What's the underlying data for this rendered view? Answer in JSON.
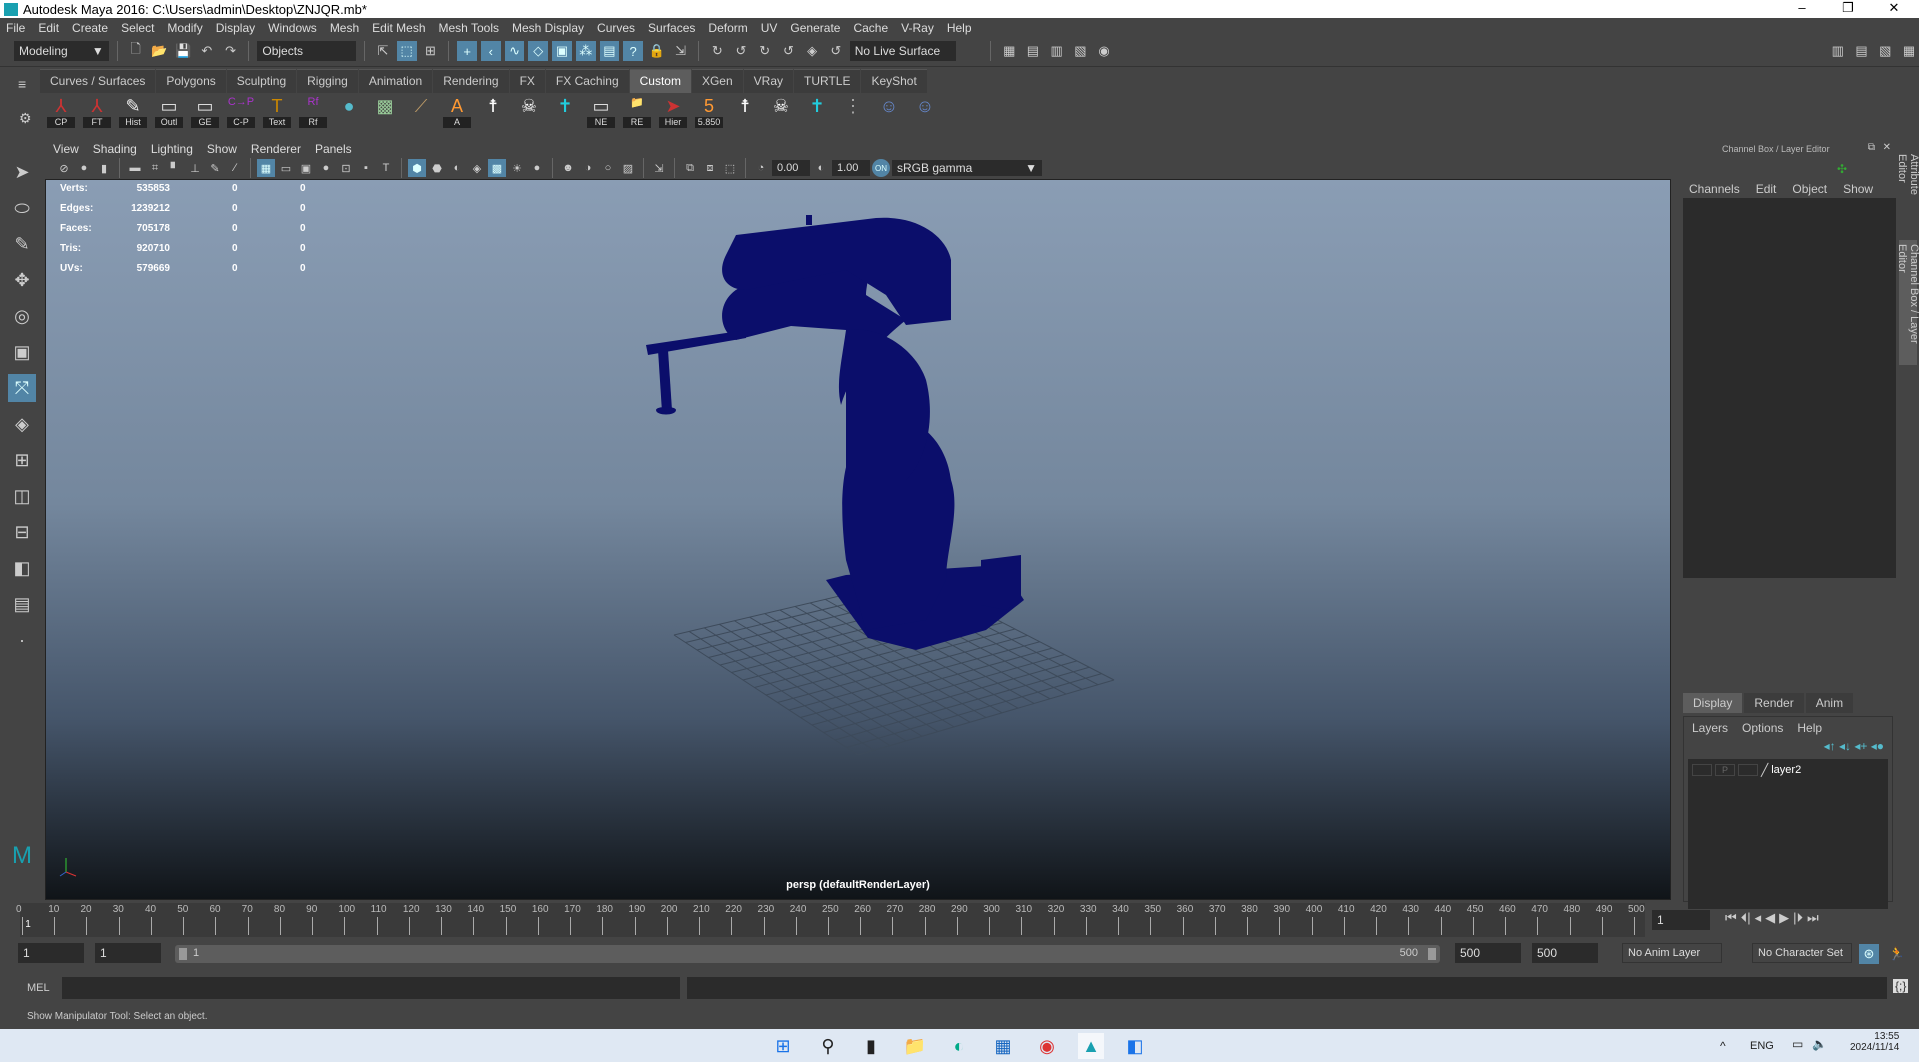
{
  "window": {
    "title": "Autodesk Maya 2016: C:\\Users\\admin\\Desktop\\ZNJQR.mb*",
    "minimize": "–",
    "restore": "❐",
    "close": "✕"
  },
  "menu": [
    "File",
    "Edit",
    "Create",
    "Select",
    "Modify",
    "Display",
    "Windows",
    "Mesh",
    "Edit Mesh",
    "Mesh Tools",
    "Mesh Display",
    "Curves",
    "Surfaces",
    "Deform",
    "UV",
    "Generate",
    "Cache",
    "V-Ray",
    "Help"
  ],
  "statusline": {
    "mode": "Modeling",
    "selection_mask": "Objects",
    "live_surface": "No Live Surface"
  },
  "shelf": {
    "tabs": [
      "Curves / Surfaces",
      "Polygons",
      "Sculpting",
      "Rigging",
      "Animation",
      "Rendering",
      "FX",
      "FX Caching",
      "Custom",
      "XGen",
      "VRay",
      "TURTLE",
      "KeyShot"
    ],
    "active_tab": "Custom",
    "buttons": [
      {
        "label": "CP",
        "icon": "axis-icon"
      },
      {
        "label": "FT",
        "icon": "axis-icon"
      },
      {
        "label": "Hist",
        "icon": "notepad-icon"
      },
      {
        "label": "Outl",
        "icon": "window-icon"
      },
      {
        "label": "GE",
        "icon": "window-icon"
      },
      {
        "label": "C-P",
        "icon": "c-p-icon"
      },
      {
        "label": "Text",
        "icon": "text-icon"
      },
      {
        "label": "Rf",
        "icon": "rf-icon"
      },
      {
        "label": "",
        "icon": "pin-icon"
      },
      {
        "label": "",
        "icon": "checker-icon"
      },
      {
        "label": "",
        "icon": "brush-icon"
      },
      {
        "label": "A",
        "icon": "a-circle-icon"
      },
      {
        "label": "",
        "icon": "skeleton-icon"
      },
      {
        "label": "",
        "icon": "skull-icon"
      },
      {
        "label": "",
        "icon": "cross-icon"
      },
      {
        "label": "NE",
        "icon": "window-icon"
      },
      {
        "label": "RE",
        "icon": "folder-icon"
      },
      {
        "label": "Hier",
        "icon": "cursor-icon"
      },
      {
        "label": "5.850",
        "icon": "five-circle-icon"
      },
      {
        "label": "",
        "icon": "skeleton-icon"
      },
      {
        "label": "",
        "icon": "skull-icon"
      },
      {
        "label": "",
        "icon": "cross-icon"
      },
      {
        "label": "",
        "icon": "graph-icon"
      },
      {
        "label": "",
        "icon": "head-icon"
      },
      {
        "label": "",
        "icon": "head-icon"
      }
    ]
  },
  "panel": {
    "menu": [
      "View",
      "Shading",
      "Lighting",
      "Show",
      "Renderer",
      "Panels"
    ],
    "exposure": "0.00",
    "gamma": "1.00",
    "color_space": "sRGB gamma",
    "camera_label": "persp (defaultRenderLayer)"
  },
  "hud": [
    {
      "label": "Verts:",
      "value": "535853",
      "a": "0",
      "b": "0"
    },
    {
      "label": "Edges:",
      "value": "1239212",
      "a": "0",
      "b": "0"
    },
    {
      "label": "Faces:",
      "value": "705178",
      "a": "0",
      "b": "0"
    },
    {
      "label": "Tris:",
      "value": "920710",
      "a": "0",
      "b": "0"
    },
    {
      "label": "UVs:",
      "value": "579669",
      "a": "0",
      "b": "0"
    }
  ],
  "channel_box": {
    "title": "Channel Box / Layer Editor",
    "menu": [
      "Channels",
      "Edit",
      "Object",
      "Show"
    ],
    "layer_tabs": [
      "Display",
      "Render",
      "Anim"
    ],
    "active_layer_tab": "Display",
    "layer_menu": [
      "Layers",
      "Options",
      "Help"
    ],
    "layers": [
      {
        "name": "layer2",
        "p": "P"
      }
    ]
  },
  "side_tabs": [
    "Attribute Editor",
    "Channel Box / Layer Editor"
  ],
  "timeline": {
    "start": 0,
    "end": 500,
    "step": 10,
    "current_frame": "1",
    "current_field": "1"
  },
  "range": {
    "start": "1",
    "playback_start": "1",
    "slider_start": "1",
    "slider_end": "500",
    "playback_end": "500",
    "end": "500",
    "anim_layer": "No Anim Layer",
    "character_set": "No Character Set"
  },
  "mel": {
    "label": "MEL"
  },
  "status": "Show Manipulator Tool: Select an object.",
  "taskbar": {
    "lang": "ENG",
    "time": "13:55",
    "date": "2024/11/14"
  },
  "colors": {
    "mesh": "#0b0e6b",
    "accent": "#5285a6",
    "viewport_top": "#8a9db4"
  }
}
